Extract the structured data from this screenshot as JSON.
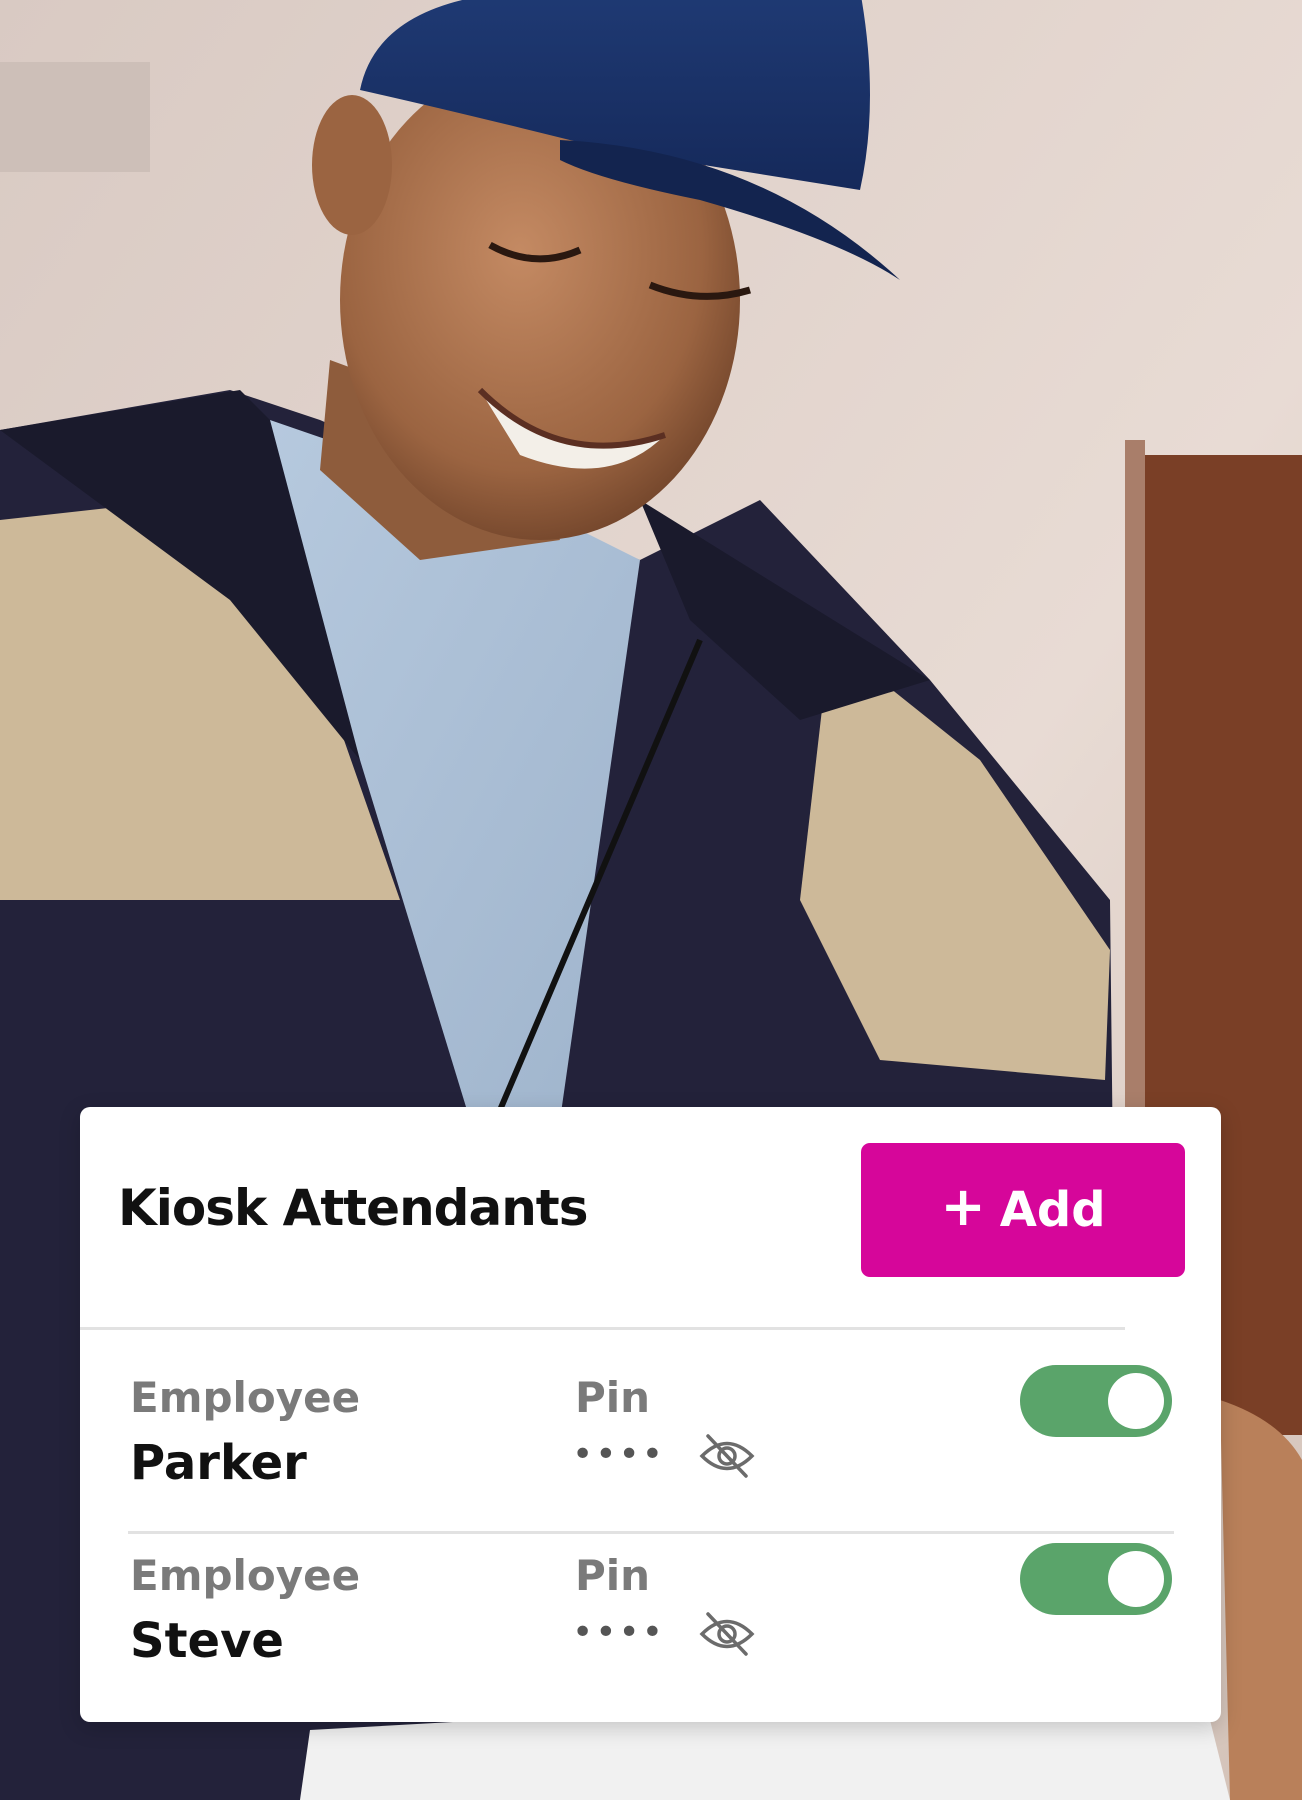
{
  "card": {
    "title": "Kiosk Attendants",
    "add_button": {
      "icon": "plus-icon",
      "plus_glyph": "+",
      "label": "Add"
    },
    "columns": {
      "employee": "Employee",
      "pin": "Pin"
    },
    "rows": [
      {
        "name": "Parker",
        "pin_masked": "••••",
        "pin_icon": "eye-off-icon",
        "enabled": true
      },
      {
        "name": "Steve",
        "pin_masked": "••••",
        "pin_icon": "eye-off-icon",
        "enabled": true
      }
    ]
  },
  "colors": {
    "accent": "#d6069a",
    "toggle_on": "#5aa46a",
    "label_gray": "#7a7a7a",
    "text": "#111111"
  }
}
